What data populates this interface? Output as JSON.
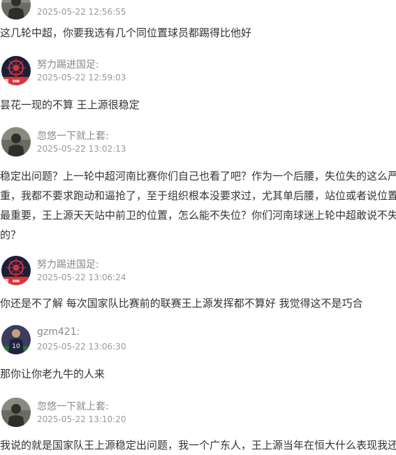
{
  "comments": [
    {
      "user": "",
      "avatar_icon": "soldier-avatar-icon",
      "time": "2025-05-22 12:56:55",
      "lines": [
        "这几轮中超，你要我选有几个同位置球员都踢得比他好"
      ]
    },
    {
      "user": "努力踢进国足:",
      "avatar_icon": "fireworks-avatar-icon",
      "time": "2025-05-22 12:59:03",
      "lines": [
        "昙花一现的不算 王上源很稳定"
      ]
    },
    {
      "user": "忽悠一下就上套:",
      "avatar_icon": "soldier-avatar-icon",
      "time": "2025-05-22 13:02:13",
      "lines": [
        "稳定出问题？上一轮中超河南比赛你们自己也看了吧？作为一个后腰，失位失的这么严",
        "重，我都不要求跑动和逼抢了，至于组织根本没要求过，尤其单后腰，站位或者说位置",
        "最重要，王上源天天站中前卫的位置，怎么能不失位？你们河南球迷上轮中超敢说不失",
        "的？"
      ]
    },
    {
      "user": "努力踢进国足:",
      "avatar_icon": "fireworks-avatar-icon",
      "time": "2025-05-22 13:06:24",
      "lines": [
        "你还是不了解 每次国家队比赛前的联赛王上源发挥都不算好 我觉得这不是巧合"
      ]
    },
    {
      "user": "gzm421:",
      "avatar_icon": "footballer-avatar-icon",
      "time": "2025-05-22 13:06:30",
      "lines": [
        "那你让你老九牛的人来"
      ]
    },
    {
      "user": "忽悠一下就上套:",
      "avatar_icon": "soldier-avatar-icon",
      "time": "2025-05-22 13:10:20",
      "lines": [
        "我说的就是国家队王上源稳定出问题，我一个广东人，王上源当年在恒大什么表现我还"
      ]
    }
  ],
  "avatar_colors": {
    "soldier_bg": "#6b6b63",
    "soldier_body": "#2e2e2a",
    "fireworks_bg": "#1a1f3a",
    "fireworks_red": "#d8343c",
    "footballer_bg": "#3a3d5c",
    "footballer_shirt": "#1b2340"
  }
}
